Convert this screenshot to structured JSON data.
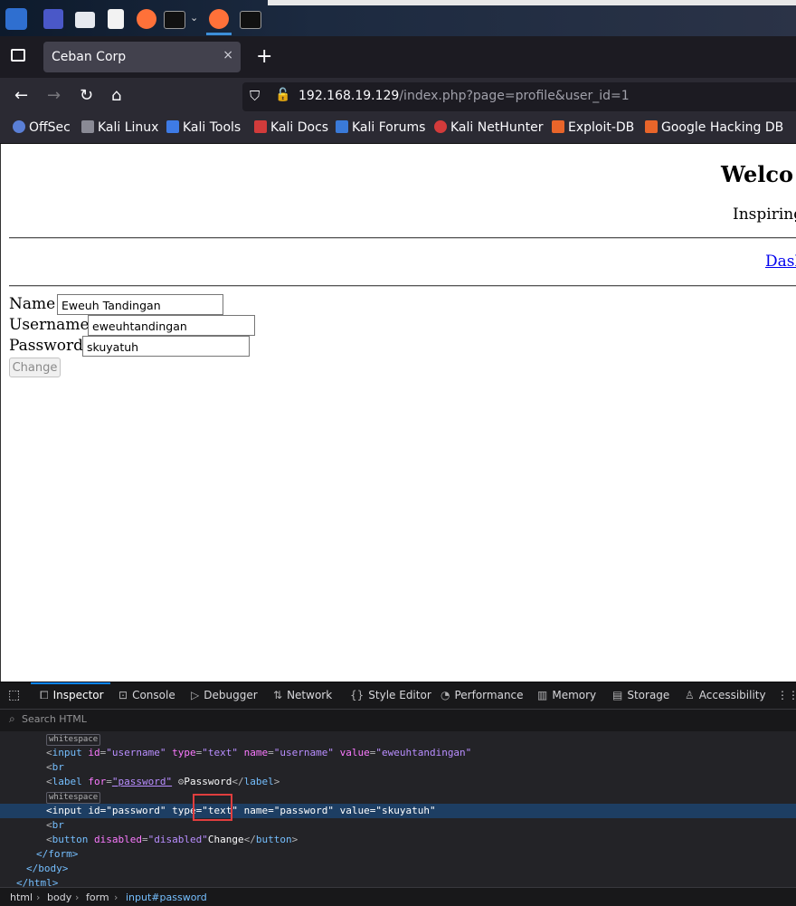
{
  "browser": {
    "tab_title": "Ceban Corp",
    "tab_close": "×",
    "new_tab": "+",
    "url_host": "192.168.19.129",
    "url_rest": "/index.php?page=profile&user_id=1",
    "bookmarks": [
      "OffSec",
      "Kali Linux",
      "Kali Tools",
      "Kali Docs",
      "Kali Forums",
      "Kali NetHunter",
      "Exploit-DB",
      "Google Hacking DB"
    ]
  },
  "page": {
    "heading": "Welco",
    "tagline": "Inspiring",
    "nav_link": "Dash",
    "name_label": "Name",
    "name_value": "Eweuh Tandingan",
    "username_label": "Username",
    "username_value": "eweuhtandingan",
    "password_label": "Password",
    "password_value": "skuyatuh",
    "change_button": "Change"
  },
  "devtools": {
    "tabs": [
      "Inspector",
      "Console",
      "Debugger",
      "Network",
      "Style Editor",
      "Performance",
      "Memory",
      "Storage",
      "Accessibility"
    ],
    "search_placeholder": "Search HTML",
    "markup": {
      "whitespace": "whitespace",
      "input": "input",
      "id_attr": "id",
      "type_attr": "type",
      "name_attr": "name",
      "value_attr": "value",
      "for_attr": "for",
      "disabled_attr": "disabled",
      "username_id": "\"username\"",
      "text_val": "\"text\"",
      "username_value": "\"eweuhtandingan\"",
      "br": "br",
      "label": "label",
      "password_id": "\"password\"",
      "password_label_text": "Password",
      "password_value": "\"skuyatuh\"",
      "button": "button",
      "disabled_val": "\"disabled\"",
      "button_text": "Change",
      "form_close": "</form>",
      "body_close": "</body>",
      "html_close": "</html>"
    },
    "breadcrumbs": [
      "html",
      "body",
      "form",
      "input#password"
    ]
  },
  "colors": {
    "selection": "#1d3e63",
    "highlight_box": "#e03e3e",
    "tag": "#75bfff",
    "attr_name": "#fb7aff",
    "attr_value": "#b98eff"
  }
}
